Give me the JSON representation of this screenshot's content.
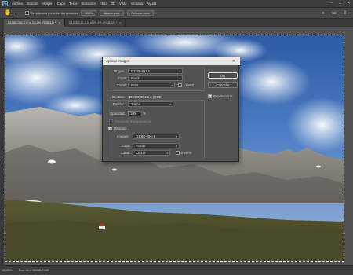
{
  "app": {
    "logo": "Ps",
    "menu": [
      "Archivo",
      "Edición",
      "Imagen",
      "Capa",
      "Texto",
      "Selección",
      "Filtro",
      "3D",
      "Vista",
      "Ventana",
      "Ayuda"
    ]
  },
  "options_bar": {
    "tool_icon": "hand-tool-icon",
    "scroll_all_label": "Desplazarse por todas las ventanas",
    "zoom_100_label": "100%",
    "fit_screen_label": "Ajustar pant.",
    "fill_screen_label": "Rellenar pant."
  },
  "tabs": [
    {
      "label": "D1060-094-1.tif al 25,2% (RGB/16) *",
      "active": true
    },
    {
      "label": "D1528-011-1.tif al 25,3% (RGB/16) *",
      "active": false
    }
  ],
  "dialog": {
    "title": "Aplicar imagen",
    "source_section": {
      "origen_label": "Origen:",
      "origen_value": "D1528-011-1",
      "capa_label": "Capa:",
      "capa_value": "Fondo",
      "canal_label": "Canal:",
      "canal_value": "RGB",
      "invertir_label": "Invertir"
    },
    "destino_label": "Destino:",
    "destino_value": "D1060-094-1... (RGB)",
    "fusion_label": "Fusión:",
    "fusion_value": "Trama",
    "opacidad_label": "Opacidad:",
    "opacidad_value": "100",
    "opacidad_unit": "%",
    "preserve_transparency_label": "Preservar transparencia",
    "mascara_label": "Máscara...",
    "mask_section": {
      "imagen_label": "Imagen:",
      "imagen_value": "D1060-094-1",
      "capa_label": "Capa:",
      "capa_value": "Fondo",
      "canal_label": "Canal:",
      "canal_value": "CIELO",
      "invertir_label": "Invertir"
    },
    "ok_label": "OK",
    "cancel_label": "Cancelar",
    "preview_label": "Previsualizar"
  },
  "status_bar": {
    "zoom": "25,25%",
    "doc_info": "Doc: 81,4 MB/86,2 MB"
  }
}
